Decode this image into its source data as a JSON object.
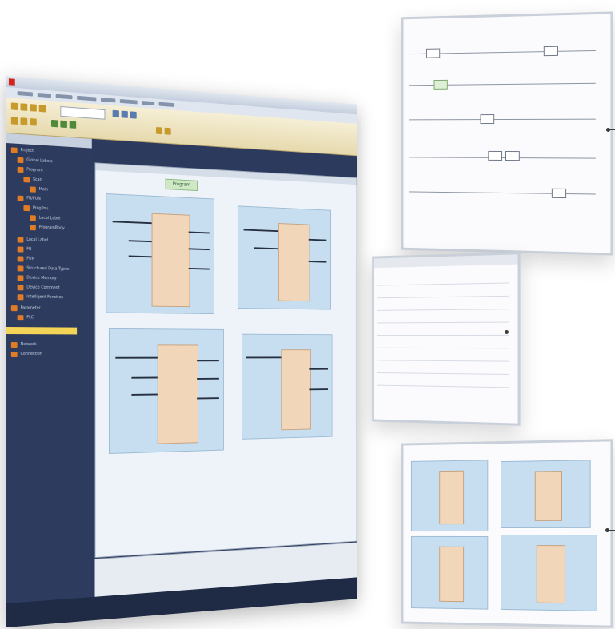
{
  "program_title": "Program",
  "tree_items": [
    "Project",
    "Global Labels",
    "Program",
    "Scan",
    "Main",
    "FB/FUN",
    "ProgPou",
    "Local Label",
    "ProgramBody",
    "Local Label",
    "FB",
    "FUN",
    "Structured Data Types",
    "Device Memory",
    "Device Comment",
    "Intelligent Function",
    "Parameter",
    "PLC",
    "Network",
    "Connection"
  ],
  "colors": {
    "sidebar": "#2d3b5f",
    "toolbar": "#e6d9ad",
    "fb_block": "#c6def0",
    "fb_core": "#f2d6b9",
    "highlight": "#f3d457"
  }
}
